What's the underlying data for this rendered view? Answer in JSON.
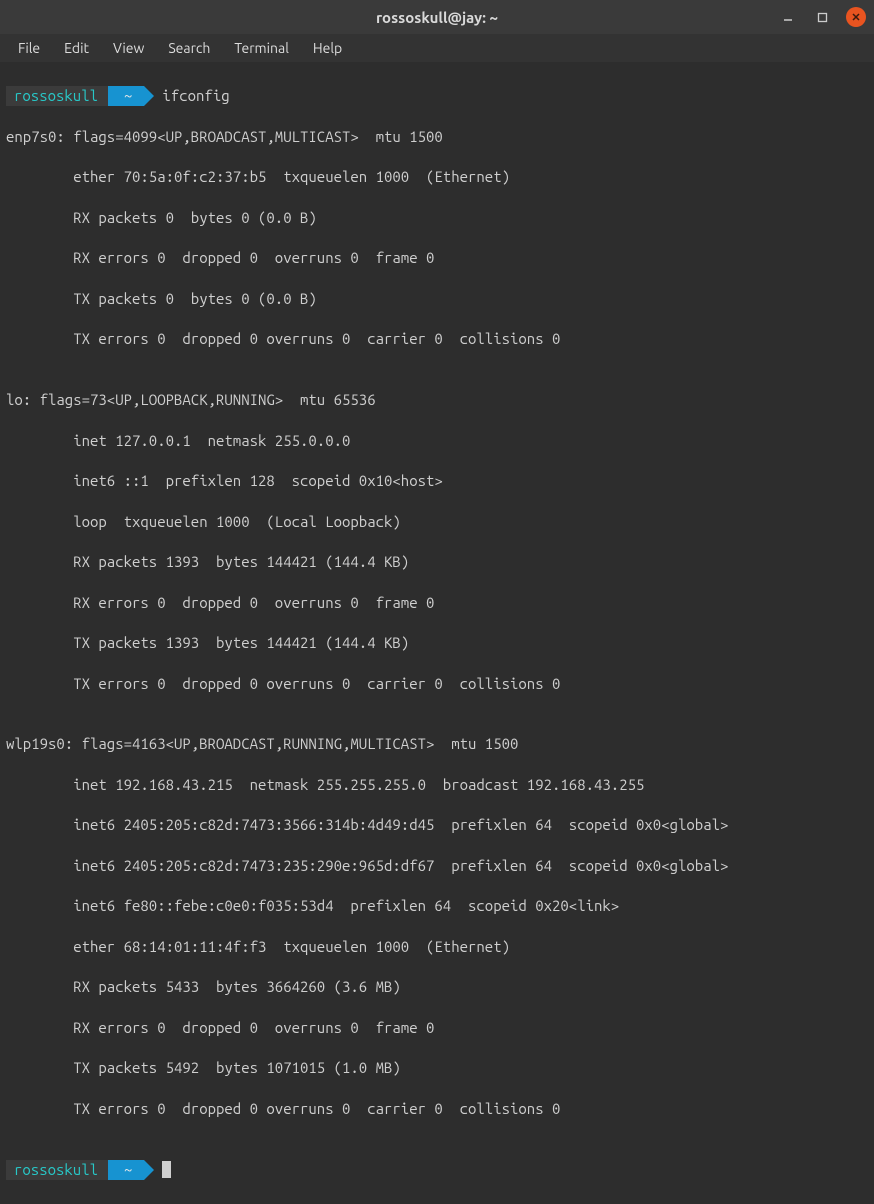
{
  "window": {
    "title": "rossoskull@jay: ~"
  },
  "menu": {
    "file": "File",
    "edit": "Edit",
    "view": "View",
    "search": "Search",
    "terminal": "Terminal",
    "help": "Help"
  },
  "prompt": {
    "user": "rossoskull",
    "path": "~",
    "command": "ifconfig"
  },
  "output": {
    "l1": "enp7s0: flags=4099<UP,BROADCAST,MULTICAST>  mtu 1500",
    "l2": "        ether 70:5a:0f:c2:37:b5  txqueuelen 1000  (Ethernet)",
    "l3": "        RX packets 0  bytes 0 (0.0 B)",
    "l4": "        RX errors 0  dropped 0  overruns 0  frame 0",
    "l5": "        TX packets 0  bytes 0 (0.0 B)",
    "l6": "        TX errors 0  dropped 0 overruns 0  carrier 0  collisions 0",
    "l7": "",
    "l8": "lo: flags=73<UP,LOOPBACK,RUNNING>  mtu 65536",
    "l9": "        inet 127.0.0.1  netmask 255.0.0.0",
    "l10": "        inet6 ::1  prefixlen 128  scopeid 0x10<host>",
    "l11": "        loop  txqueuelen 1000  (Local Loopback)",
    "l12": "        RX packets 1393  bytes 144421 (144.4 KB)",
    "l13": "        RX errors 0  dropped 0  overruns 0  frame 0",
    "l14": "        TX packets 1393  bytes 144421 (144.4 KB)",
    "l15": "        TX errors 0  dropped 0 overruns 0  carrier 0  collisions 0",
    "l16": "",
    "l17": "wlp19s0: flags=4163<UP,BROADCAST,RUNNING,MULTICAST>  mtu 1500",
    "l18": "        inet 192.168.43.215  netmask 255.255.255.0  broadcast 192.168.43.255",
    "l19": "        inet6 2405:205:c82d:7473:3566:314b:4d49:d45  prefixlen 64  scopeid 0x0<global>",
    "l20": "        inet6 2405:205:c82d:7473:235:290e:965d:df67  prefixlen 64  scopeid 0x0<global>",
    "l21": "        inet6 fe80::febe:c0e0:f035:53d4  prefixlen 64  scopeid 0x20<link>",
    "l22": "        ether 68:14:01:11:4f:f3  txqueuelen 1000  (Ethernet)",
    "l23": "        RX packets 5433  bytes 3664260 (3.6 MB)",
    "l24": "        RX errors 0  dropped 0  overruns 0  frame 0",
    "l25": "        TX packets 5492  bytes 1071015 (1.0 MB)",
    "l26": "        TX errors 0  dropped 0 overruns 0  carrier 0  collisions 0",
    "l27": ""
  },
  "prompt2": {
    "user": "rossoskull",
    "path": "~"
  }
}
